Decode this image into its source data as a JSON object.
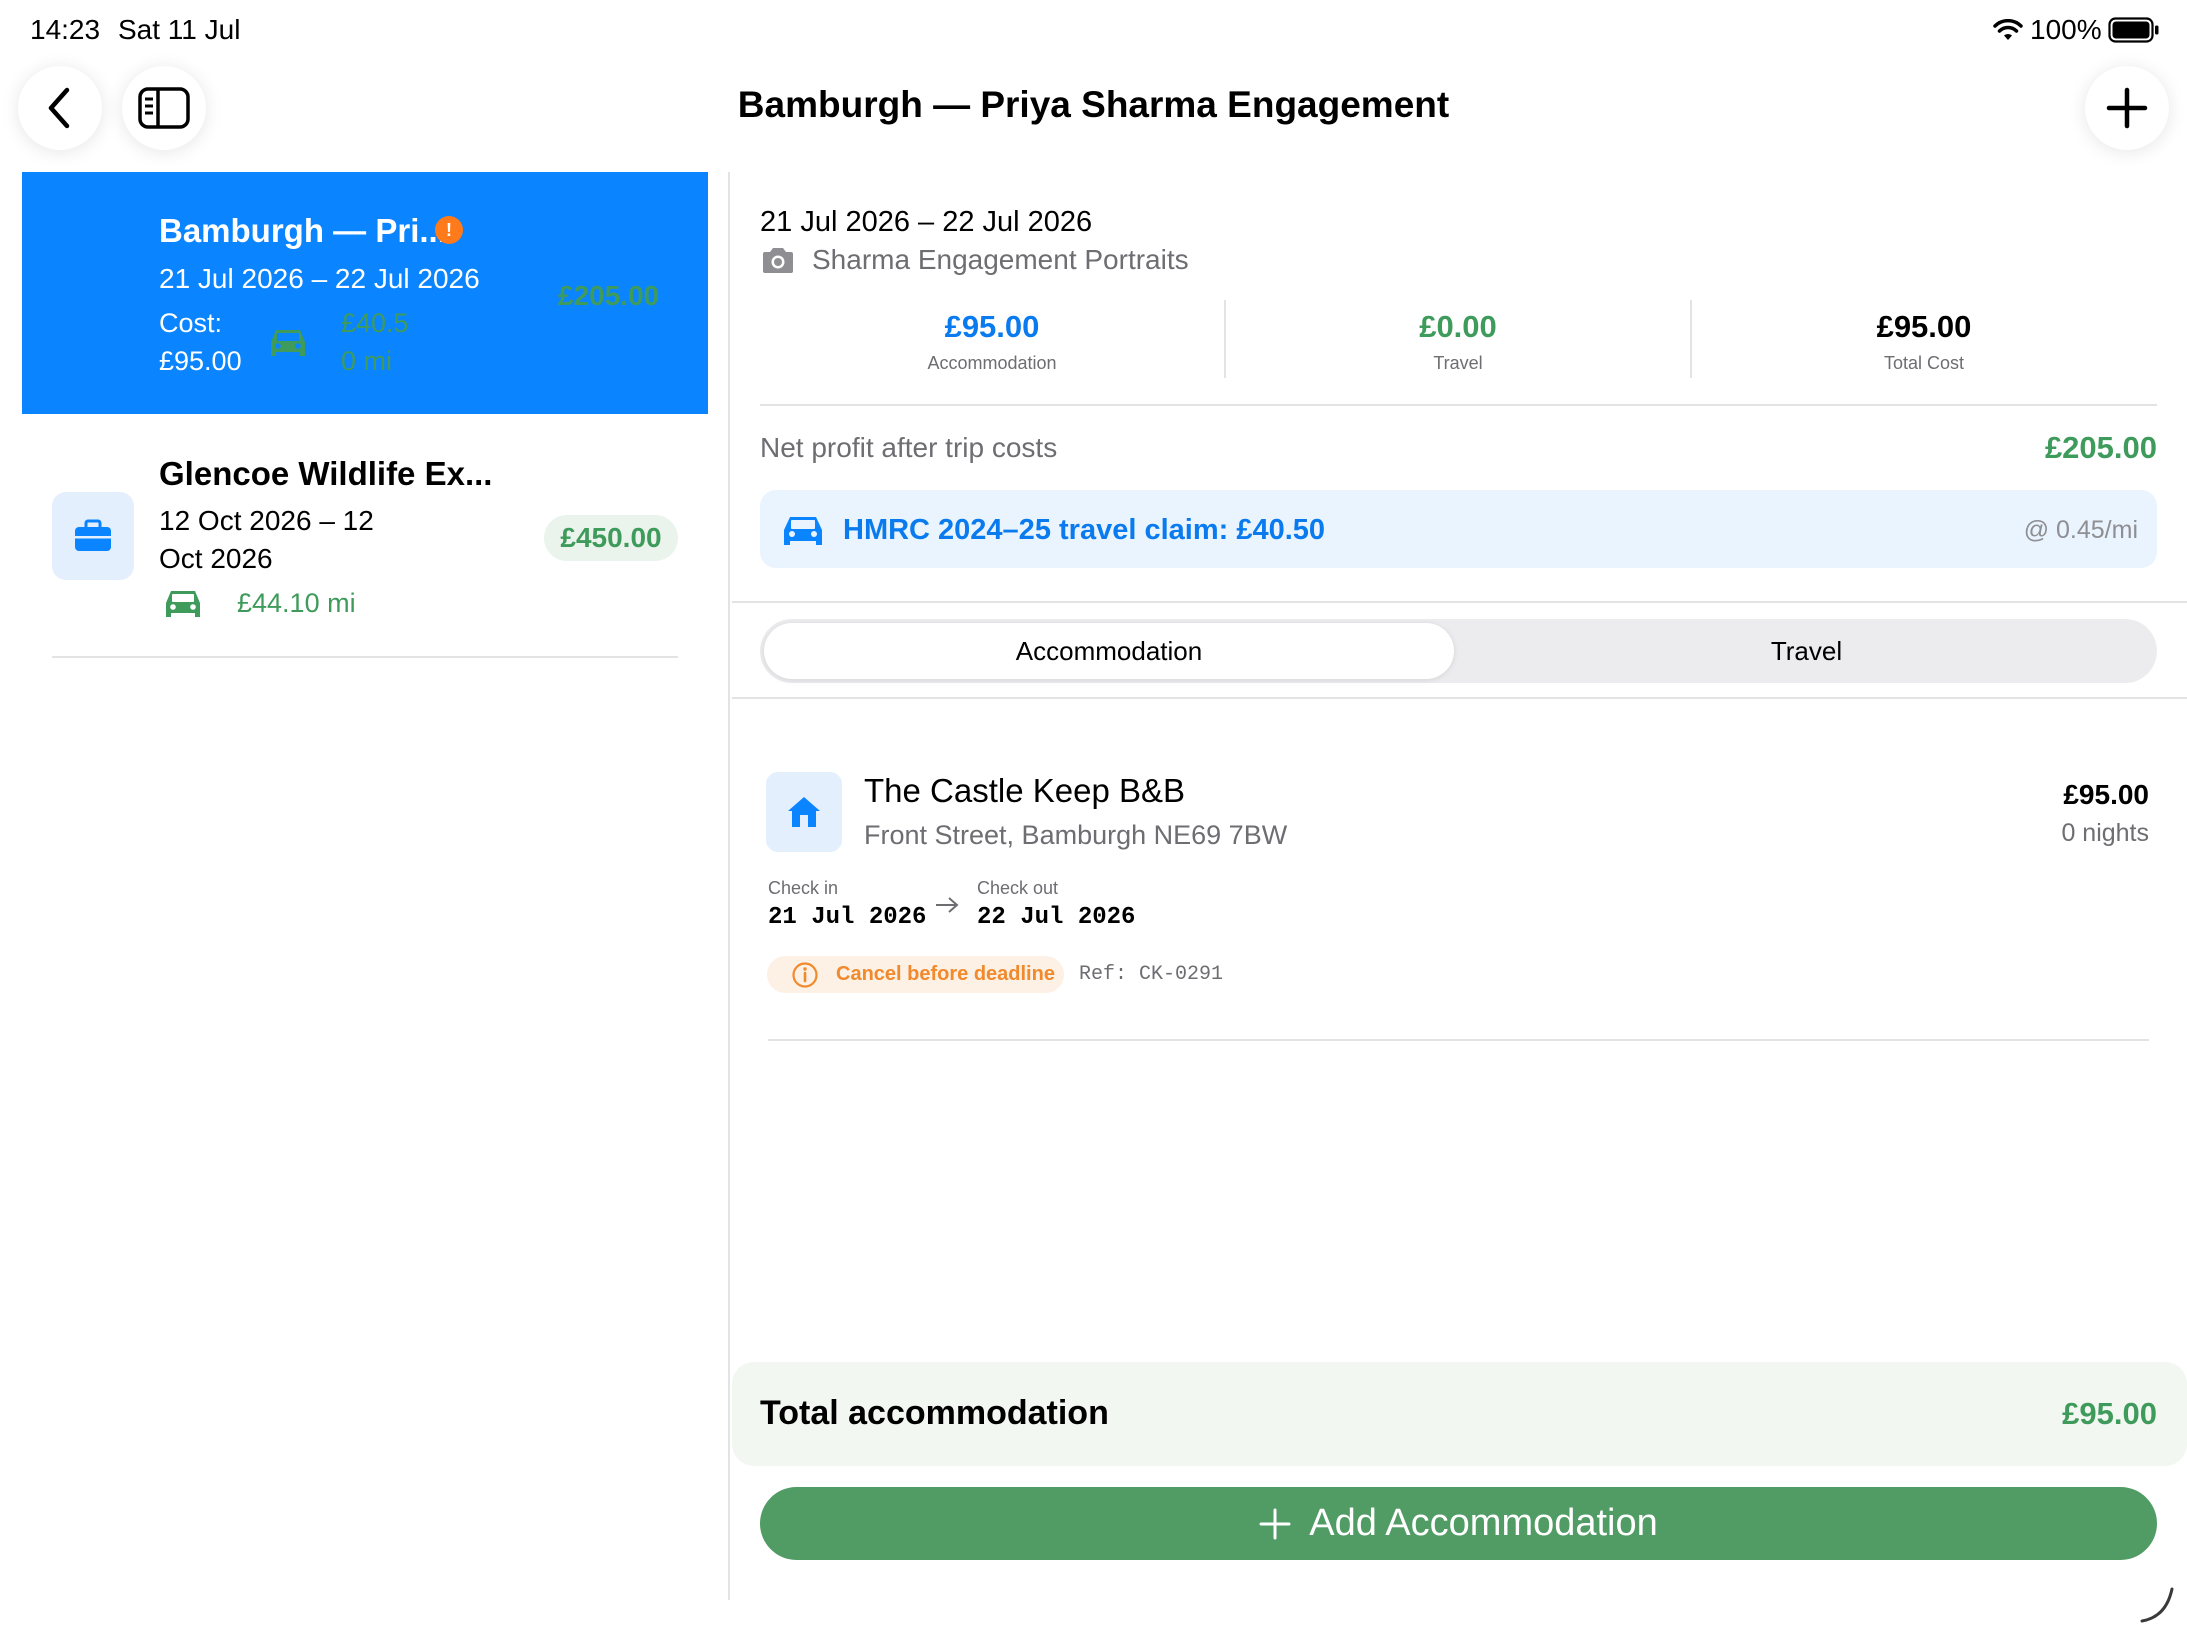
{
  "status": {
    "time": "14:23",
    "date": "Sat 11 Jul",
    "battery": "100%"
  },
  "nav": {
    "title": "Bamburgh — Priya Sharma Engagement"
  },
  "sidebar": {
    "items": [
      {
        "title": "Bamburgh — Pri...",
        "dates": "21 Jul 2026 – 22 Jul 2026",
        "cost_label": "Cost:",
        "cost_value": "£95.00",
        "claim": "£40.5",
        "miles": "0 mi",
        "profit": "£205.00",
        "alert_color": "#ff7a1a"
      },
      {
        "title": "Glencoe Wildlife Ex...",
        "dates_line1": "12 Oct 2026 – 12",
        "dates_line2": "Oct 2026",
        "claim": "£44.10 mi",
        "profit": "£450.00",
        "icon": "briefcase-icon"
      }
    ]
  },
  "detail": {
    "dates": "21 Jul 2026 – 22 Jul 2026",
    "shoot": "Sharma Engagement Portraits",
    "metrics": [
      {
        "value": "£95.00",
        "label": "Accommodation",
        "color": "#0a7bef"
      },
      {
        "value": "£0.00",
        "label": "Travel",
        "color": "#3f9b5b"
      },
      {
        "value": "£95.00",
        "label": "Total Cost",
        "color": "#000000"
      }
    ],
    "net_profit_label": "Net profit after trip costs",
    "net_profit_value": "£205.00",
    "claim_text": "HMRC 2024–25 travel claim: £40.50",
    "claim_rate": "@ 0.45/mi",
    "tabs": [
      "Accommodation",
      "Travel"
    ],
    "accommodation": {
      "name": "The Castle Keep B&B",
      "address": "Front Street, Bamburgh NE69 7BW",
      "price": "£95.00",
      "nights": "0 nights",
      "check_in_label": "Check in",
      "check_in": "21 Jul 2026",
      "check_out_label": "Check out",
      "check_out": "22 Jul 2026",
      "warning": "Cancel before deadline",
      "ref": "Ref: CK-0291"
    },
    "total_label": "Total accommodation",
    "total_value": "£95.00",
    "add_button": "Add Accommodation"
  },
  "colors": {
    "accent": "#0a84ff",
    "green": "#519b64",
    "orange": "#f08a2c"
  }
}
